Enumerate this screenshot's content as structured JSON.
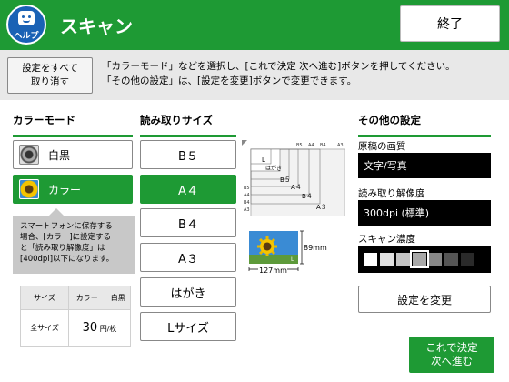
{
  "header": {
    "help_label": "ヘルプ",
    "title": "スキャン",
    "end_label": "終了"
  },
  "toolbar": {
    "reset_line1": "設定をすべて",
    "reset_line2": "取り消す",
    "instruction_line1": "「カラーモード」などを選択し、[これで決定 次へ進む]ボタンを押してください。",
    "instruction_line2": "「その他の設定」は、[設定を変更]ボタンで変更できます。"
  },
  "color_mode": {
    "title": "カラーモード",
    "options": [
      {
        "label": "白黒",
        "icon": "sunflower-bw-icon",
        "selected": false
      },
      {
        "label": "カラー",
        "icon": "sunflower-color-icon",
        "selected": true
      }
    ],
    "tooltip_lines": [
      "スマートフォンに保存する",
      "場合、[カラー]に設定する",
      "と「読み取り解像度」は",
      "[400dpi]以下になります。"
    ]
  },
  "price_table": {
    "headers": [
      "サイズ",
      "カラー",
      "白黒"
    ],
    "row_label": "全サイズ",
    "price": "30",
    "unit": "円/枚"
  },
  "scan_size": {
    "title": "読み取りサイズ",
    "options": [
      {
        "label": "B５",
        "selected": false
      },
      {
        "label": "A４",
        "selected": true
      },
      {
        "label": "B４",
        "selected": false
      },
      {
        "label": "A３",
        "selected": false
      },
      {
        "label": "はがき",
        "selected": false
      },
      {
        "label": "Lサイズ",
        "selected": false
      }
    ]
  },
  "diagram": {
    "top_labels": [
      "B5",
      "A4",
      "B4",
      "A3"
    ],
    "left_labels": [
      "B5",
      "A4",
      "B4",
      "A3"
    ],
    "inner_labels": {
      "L": "L",
      "hagaki": "はがき",
      "B5": "B５",
      "A4": "A４",
      "B4": "B４",
      "A3": "A３"
    },
    "photo_height": "89mm",
    "photo_width": "127mm",
    "photo_corner": "L"
  },
  "other_settings": {
    "title": "その他の設定",
    "quality_label": "原稿の画質",
    "quality_value": "文字/写真",
    "resolution_label": "読み取り解像度",
    "resolution_value": "300dpi (標準)",
    "density_label": "スキャン濃度",
    "density_levels": [
      "#ffffff",
      "#e0e0e0",
      "#c4c4c4",
      "#a8a8a8",
      "#888888",
      "#555555",
      "#2a2a2a",
      "#000000"
    ],
    "density_selected_index": 3,
    "change_label": "設定を変更"
  },
  "footer": {
    "next_line1": "これで決定",
    "next_line2": "次へ進む"
  },
  "colors": {
    "accent_green": "#1e9a34",
    "help_blue": "#1a62b5"
  }
}
